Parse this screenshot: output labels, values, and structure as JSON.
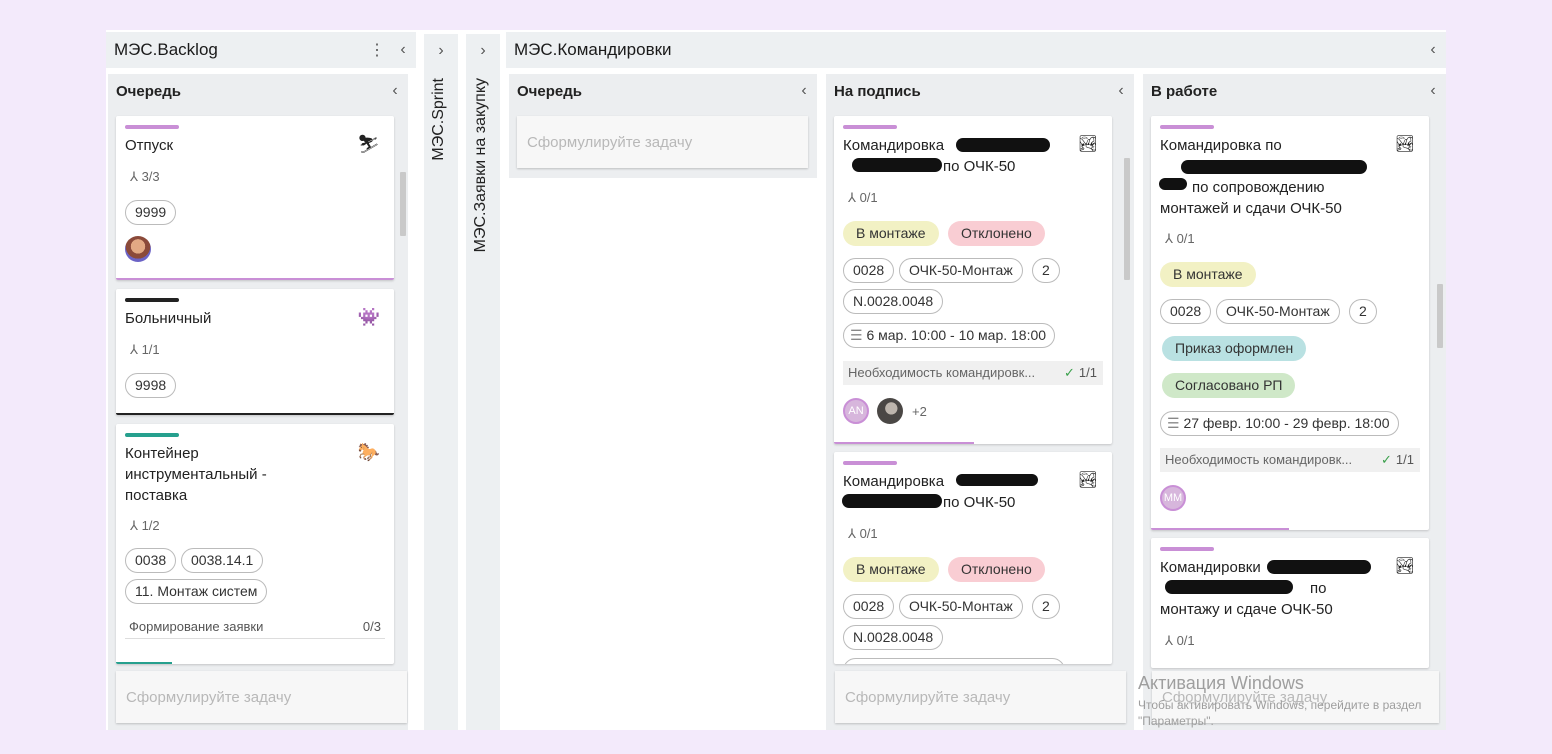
{
  "backlog": {
    "title": "МЭС.Backlog",
    "menu_icon": "⋮",
    "collapse_icon": "‹",
    "column": {
      "title": "Очередь",
      "cards": [
        {
          "title": "Отпуск",
          "icon": "skier-icon",
          "subtasks": "3/3",
          "chips": [
            "9999"
          ],
          "stripe": "#c98fd6"
        },
        {
          "title": "Больничный",
          "icon": "monster-icon",
          "subtasks": "1/1",
          "chips": [
            "9998"
          ],
          "stripe": "#222222"
        },
        {
          "title": "Контейнер инструментальный - поставка",
          "icon": "horse-icon",
          "subtasks": "1/2",
          "chips": [
            "0038",
            "0038.14.1",
            "11. Монтаж систем"
          ],
          "checklist": {
            "label": "Формирование заявки",
            "count": "0/3"
          },
          "stripe": "#26a08e"
        }
      ]
    },
    "new_task_placeholder": "Сформулируйте задачу"
  },
  "sprint": {
    "label": "МЭС.Sprint",
    "expand_icon": "›"
  },
  "purchase": {
    "label": "МЭС.Заявки на закупку",
    "expand_icon": "›"
  },
  "trips": {
    "title": "МЭС.Командировки",
    "collapse_icon": "‹",
    "columns": [
      {
        "title": "Очередь",
        "placeholder": "Сформулируйте задачу"
      },
      {
        "title": "На подпись",
        "cards": [
          {
            "title_1": "Командировка",
            "title_2": "по ОЧК-50",
            "subtasks": "0/1",
            "tags": [
              "В монтаже",
              "Отклонено"
            ],
            "chips": [
              "0028",
              "ОЧК-50-Монтаж",
              "2",
              "N.0028.0048"
            ],
            "dates": "6 мар. 10:00 - 10 мар. 18:00",
            "need": "Необходимость командировк...",
            "need_count": "1/1",
            "avatar_initials": "AN",
            "more": "+2"
          },
          {
            "title_1": "Командировка",
            "title_2": "по ОЧК-50",
            "subtasks": "0/1",
            "tags": [
              "В монтаже",
              "Отклонено"
            ],
            "chips": [
              "0028",
              "ОЧК-50-Монтаж",
              "2",
              "N.0028.0048"
            ]
          }
        ],
        "new_task_placeholder": "Сформулируйте задачу"
      },
      {
        "title": "В работе",
        "cards": [
          {
            "title_1": "Командировка по",
            "title_2": "по сопровождению",
            "title_3": "монтажей и сдачи ОЧК-50",
            "subtasks": "0/1",
            "tags": [
              "В монтаже"
            ],
            "chips": [
              "0028",
              "ОЧК-50-Монтаж",
              "2"
            ],
            "tags2": [
              "Приказ оформлен",
              "Согласовано РП"
            ],
            "dates": "27 февр. 10:00 - 29 февр. 18:00",
            "need": "Необходимость командировк...",
            "need_count": "1/1",
            "avatar_initials": "MM"
          },
          {
            "title_1": "Командировки",
            "title_2": "по",
            "title_3": "монтажу и сдаче ОЧК-50",
            "subtasks": "0/1"
          }
        ],
        "new_task_placeholder": "Сформулируйте задачу"
      }
    ]
  },
  "watermark": {
    "title": "Активация Windows",
    "text": "Чтобы активировать Windows, перейдите в раздел \"Параметры\"."
  }
}
